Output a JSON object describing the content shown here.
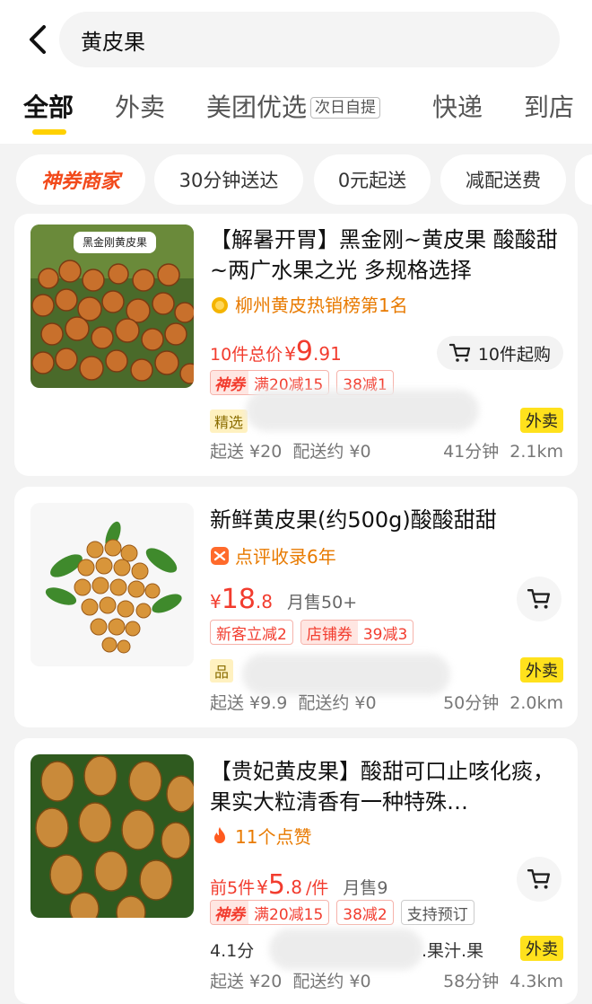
{
  "search": {
    "query": "黄皮果"
  },
  "tabs": [
    {
      "label": "全部"
    },
    {
      "label": "外卖"
    },
    {
      "label": "美团优选",
      "badge": "次日自提"
    },
    {
      "label": "快递"
    },
    {
      "label": "到店"
    }
  ],
  "filters": [
    {
      "label": "神券商家"
    },
    {
      "label": "30分钟送达"
    },
    {
      "label": "0元起送"
    },
    {
      "label": "减配送费"
    }
  ],
  "products": [
    {
      "thumb_label": "黑金刚黄皮果",
      "title": "【解暑开胃】黑金刚~黄皮果 酸酸甜~两广水果之光 多规格选择",
      "rank": "柳州黄皮热销榜第1名",
      "price_prefix": "10件总价",
      "currency": "¥",
      "price_int": "9",
      "price_dec": ".91",
      "cart_label": "10件起购",
      "coupon_tag": "神券",
      "tags": [
        "满20减15",
        "38减1"
      ],
      "label_left": "精选",
      "label_right": "外卖",
      "delivery_min": "起送 ¥20",
      "delivery_fee": "配送约 ¥0",
      "delivery_time": "41分钟",
      "distance": "2.1km"
    },
    {
      "title": "新鲜黄皮果(约500g)酸酸甜甜",
      "rank": "点评收录6年",
      "currency": "¥",
      "price_int": "18",
      "price_dec": ".8",
      "sold": "月售50+",
      "tags": [
        "新客立减2"
      ],
      "shop_coupon": {
        "left": "店铺券",
        "right": "39减3"
      },
      "label_left": "品",
      "label_right": "外卖",
      "delivery_min": "起送 ¥9.9",
      "delivery_fee": "配送约 ¥0",
      "delivery_time": "50分钟",
      "distance": "2.0km"
    },
    {
      "title": "【贵妃黄皮果】酸甜可口止咳化痰，果实大粒清香有一种特殊…",
      "rank": "11个点赞",
      "price_prefix": "前5件",
      "currency": "¥",
      "price_int": "5",
      "price_dec": ".8",
      "price_unit": "/件",
      "sold": "月售9",
      "coupon_tag": "神券",
      "tags": [
        "满20减15",
        "38减2"
      ],
      "gray_tag": "支持预订",
      "label_left": "4.1分",
      "label_mid": ".果汁.果",
      "label_right": "外卖",
      "delivery_min": "起送 ¥20",
      "delivery_fee": "配送约 ¥0",
      "delivery_time": "58分钟",
      "distance": "4.3km"
    }
  ],
  "colors": {
    "accent_yellow": "#ffd100",
    "price_red": "#f23c2e",
    "rank_orange": "#e87a00"
  }
}
